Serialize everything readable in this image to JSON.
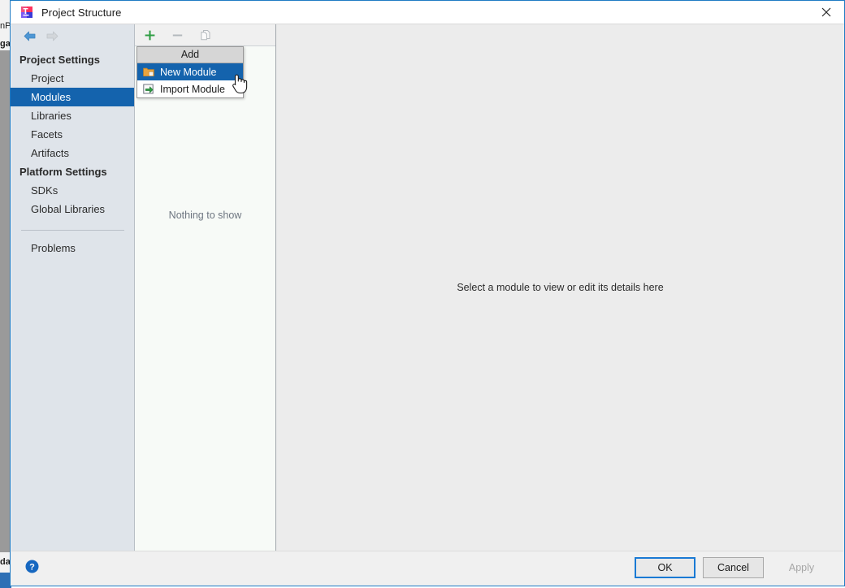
{
  "background": {
    "fragment_top_1": "nP",
    "fragment_top_2": "ga",
    "fragment_bottom": "da"
  },
  "titlebar": {
    "icon": "intellij-idea-icon",
    "title": "Project Structure",
    "close_label": "✕"
  },
  "nav": {
    "back_icon": "arrow-left-icon",
    "forward_icon": "arrow-right-icon"
  },
  "sidebar": {
    "groups": [
      {
        "label": "Project Settings",
        "items": [
          {
            "label": "Project",
            "selected": false
          },
          {
            "label": "Modules",
            "selected": true
          },
          {
            "label": "Libraries",
            "selected": false
          },
          {
            "label": "Facets",
            "selected": false
          },
          {
            "label": "Artifacts",
            "selected": false
          }
        ]
      },
      {
        "label": "Platform Settings",
        "items": [
          {
            "label": "SDKs",
            "selected": false
          },
          {
            "label": "Global Libraries",
            "selected": false
          }
        ]
      }
    ],
    "footer_items": [
      {
        "label": "Problems",
        "selected": false
      }
    ]
  },
  "middle_panel": {
    "toolbar": [
      {
        "name": "add-button",
        "icon": "plus-icon",
        "enabled": true
      },
      {
        "name": "remove-button",
        "icon": "minus-icon",
        "enabled": false
      },
      {
        "name": "copy-button",
        "icon": "copy-icon",
        "enabled": false
      }
    ],
    "empty_text": "Nothing to show"
  },
  "popup_menu": {
    "header": "Add",
    "items": [
      {
        "label": "New Module",
        "icon": "folder-new-icon",
        "highlighted": true
      },
      {
        "label": "Import Module",
        "icon": "import-arrow-icon",
        "highlighted": false
      }
    ]
  },
  "right_panel": {
    "empty_text": "Select a module to view or edit its details here"
  },
  "bottom_bar": {
    "help_icon": "help-question-icon",
    "buttons": [
      {
        "label": "OK",
        "state": "default"
      },
      {
        "label": "Cancel",
        "state": "normal"
      },
      {
        "label": "Apply",
        "state": "disabled"
      }
    ]
  },
  "cursor": {
    "icon": "hand-pointer-cursor"
  },
  "colors": {
    "accent_blue": "#1463ad",
    "dialog_border": "#1f7bc4",
    "sidebar_bg": "#dfe4ea",
    "mid_bg": "#f7faf7",
    "right_bg": "#ececec",
    "bottom_bg": "#f0f0f0",
    "focus_ring": "#1a7ad4"
  }
}
